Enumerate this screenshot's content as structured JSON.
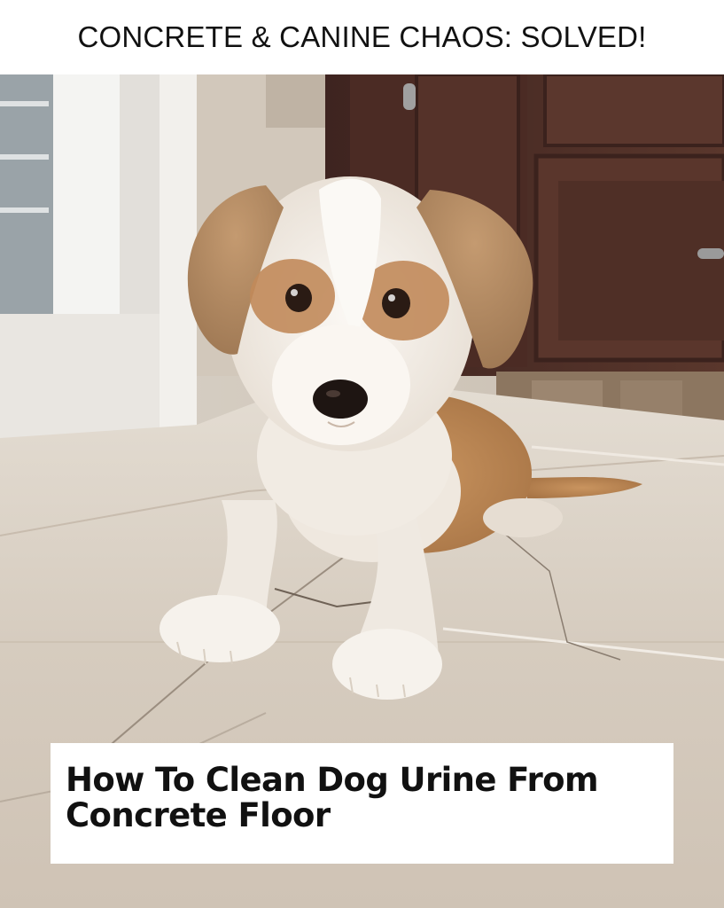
{
  "header": {
    "title": "CONCRETE & CANINE CHAOS: SOLVED!"
  },
  "photo": {
    "subject": "puppy-lying-on-tile-floor"
  },
  "caption": {
    "line1": "How To Clean Dog Urine From",
    "line2": "Concrete Floor"
  },
  "colors": {
    "header_bg": "#ffffff",
    "text": "#111111",
    "floor": "#d9cfc2",
    "cabinet": "#4a2a22",
    "fur_tan": "#b98a5c",
    "fur_white": "#f3eee8"
  }
}
